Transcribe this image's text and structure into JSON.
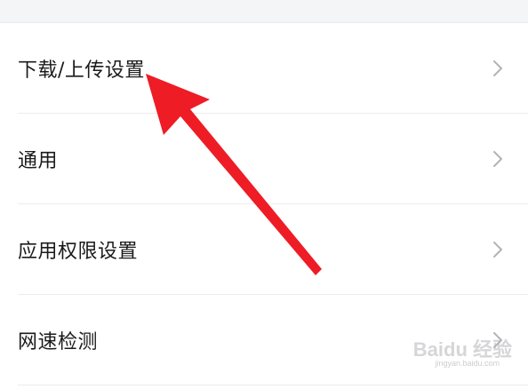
{
  "settings": {
    "items": [
      {
        "label": "下载/上传设置",
        "icon": "chevron-right-icon"
      },
      {
        "label": "通用",
        "icon": "chevron-right-icon"
      },
      {
        "label": "应用权限设置",
        "icon": "chevron-right-icon"
      },
      {
        "label": "网速检测",
        "icon": "chevron-right-icon"
      }
    ]
  },
  "annotation": {
    "arrow_color": "#ee1c25",
    "arrow_icon": "red-arrow-icon"
  },
  "watermark": {
    "brand": "Baidu 经验",
    "domain": "jingyan.baidu.com"
  },
  "colors": {
    "background": "#ffffff",
    "top_band": "#f4f5f7",
    "divider": "#ececef",
    "text": "#1b1b1b",
    "chevron": "#b3b3b8"
  }
}
